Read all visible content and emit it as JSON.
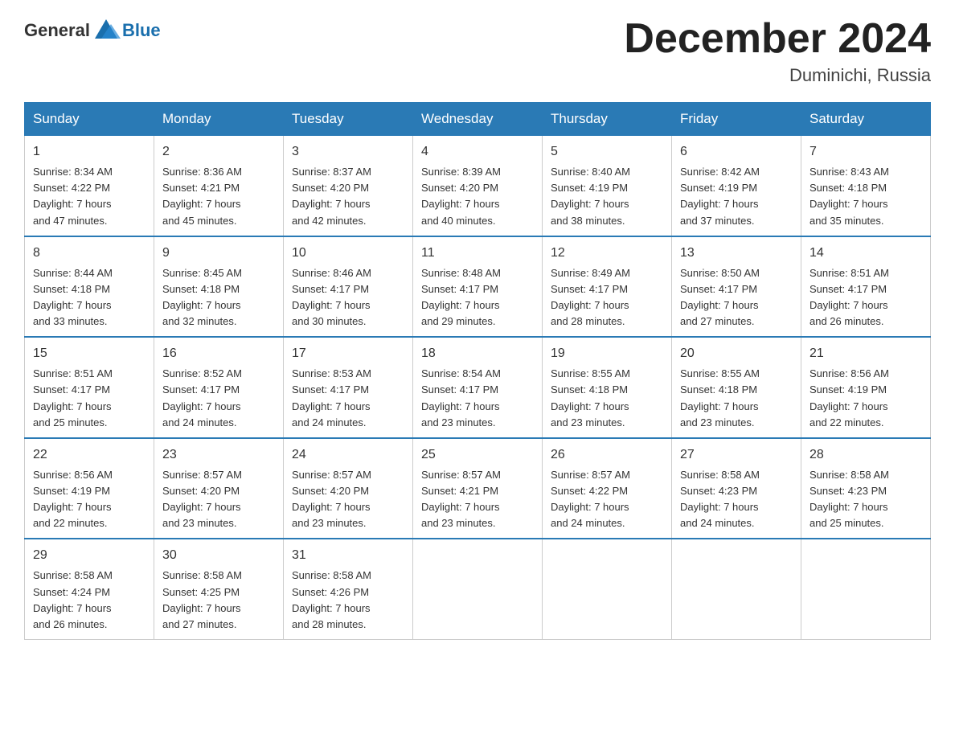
{
  "header": {
    "logo_general": "General",
    "logo_blue": "Blue",
    "month_title": "December 2024",
    "location": "Duminichi, Russia"
  },
  "days_of_week": [
    "Sunday",
    "Monday",
    "Tuesday",
    "Wednesday",
    "Thursday",
    "Friday",
    "Saturday"
  ],
  "weeks": [
    [
      {
        "day": "1",
        "sunrise": "8:34 AM",
        "sunset": "4:22 PM",
        "daylight": "7 hours and 47 minutes."
      },
      {
        "day": "2",
        "sunrise": "8:36 AM",
        "sunset": "4:21 PM",
        "daylight": "7 hours and 45 minutes."
      },
      {
        "day": "3",
        "sunrise": "8:37 AM",
        "sunset": "4:20 PM",
        "daylight": "7 hours and 42 minutes."
      },
      {
        "day": "4",
        "sunrise": "8:39 AM",
        "sunset": "4:20 PM",
        "daylight": "7 hours and 40 minutes."
      },
      {
        "day": "5",
        "sunrise": "8:40 AM",
        "sunset": "4:19 PM",
        "daylight": "7 hours and 38 minutes."
      },
      {
        "day": "6",
        "sunrise": "8:42 AM",
        "sunset": "4:19 PM",
        "daylight": "7 hours and 37 minutes."
      },
      {
        "day": "7",
        "sunrise": "8:43 AM",
        "sunset": "4:18 PM",
        "daylight": "7 hours and 35 minutes."
      }
    ],
    [
      {
        "day": "8",
        "sunrise": "8:44 AM",
        "sunset": "4:18 PM",
        "daylight": "7 hours and 33 minutes."
      },
      {
        "day": "9",
        "sunrise": "8:45 AM",
        "sunset": "4:18 PM",
        "daylight": "7 hours and 32 minutes."
      },
      {
        "day": "10",
        "sunrise": "8:46 AM",
        "sunset": "4:17 PM",
        "daylight": "7 hours and 30 minutes."
      },
      {
        "day": "11",
        "sunrise": "8:48 AM",
        "sunset": "4:17 PM",
        "daylight": "7 hours and 29 minutes."
      },
      {
        "day": "12",
        "sunrise": "8:49 AM",
        "sunset": "4:17 PM",
        "daylight": "7 hours and 28 minutes."
      },
      {
        "day": "13",
        "sunrise": "8:50 AM",
        "sunset": "4:17 PM",
        "daylight": "7 hours and 27 minutes."
      },
      {
        "day": "14",
        "sunrise": "8:51 AM",
        "sunset": "4:17 PM",
        "daylight": "7 hours and 26 minutes."
      }
    ],
    [
      {
        "day": "15",
        "sunrise": "8:51 AM",
        "sunset": "4:17 PM",
        "daylight": "7 hours and 25 minutes."
      },
      {
        "day": "16",
        "sunrise": "8:52 AM",
        "sunset": "4:17 PM",
        "daylight": "7 hours and 24 minutes."
      },
      {
        "day": "17",
        "sunrise": "8:53 AM",
        "sunset": "4:17 PM",
        "daylight": "7 hours and 24 minutes."
      },
      {
        "day": "18",
        "sunrise": "8:54 AM",
        "sunset": "4:17 PM",
        "daylight": "7 hours and 23 minutes."
      },
      {
        "day": "19",
        "sunrise": "8:55 AM",
        "sunset": "4:18 PM",
        "daylight": "7 hours and 23 minutes."
      },
      {
        "day": "20",
        "sunrise": "8:55 AM",
        "sunset": "4:18 PM",
        "daylight": "7 hours and 23 minutes."
      },
      {
        "day": "21",
        "sunrise": "8:56 AM",
        "sunset": "4:19 PM",
        "daylight": "7 hours and 22 minutes."
      }
    ],
    [
      {
        "day": "22",
        "sunrise": "8:56 AM",
        "sunset": "4:19 PM",
        "daylight": "7 hours and 22 minutes."
      },
      {
        "day": "23",
        "sunrise": "8:57 AM",
        "sunset": "4:20 PM",
        "daylight": "7 hours and 23 minutes."
      },
      {
        "day": "24",
        "sunrise": "8:57 AM",
        "sunset": "4:20 PM",
        "daylight": "7 hours and 23 minutes."
      },
      {
        "day": "25",
        "sunrise": "8:57 AM",
        "sunset": "4:21 PM",
        "daylight": "7 hours and 23 minutes."
      },
      {
        "day": "26",
        "sunrise": "8:57 AM",
        "sunset": "4:22 PM",
        "daylight": "7 hours and 24 minutes."
      },
      {
        "day": "27",
        "sunrise": "8:58 AM",
        "sunset": "4:23 PM",
        "daylight": "7 hours and 24 minutes."
      },
      {
        "day": "28",
        "sunrise": "8:58 AM",
        "sunset": "4:23 PM",
        "daylight": "7 hours and 25 minutes."
      }
    ],
    [
      {
        "day": "29",
        "sunrise": "8:58 AM",
        "sunset": "4:24 PM",
        "daylight": "7 hours and 26 minutes."
      },
      {
        "day": "30",
        "sunrise": "8:58 AM",
        "sunset": "4:25 PM",
        "daylight": "7 hours and 27 minutes."
      },
      {
        "day": "31",
        "sunrise": "8:58 AM",
        "sunset": "4:26 PM",
        "daylight": "7 hours and 28 minutes."
      },
      null,
      null,
      null,
      null
    ]
  ],
  "labels": {
    "sunrise": "Sunrise:",
    "sunset": "Sunset:",
    "daylight": "Daylight:"
  }
}
